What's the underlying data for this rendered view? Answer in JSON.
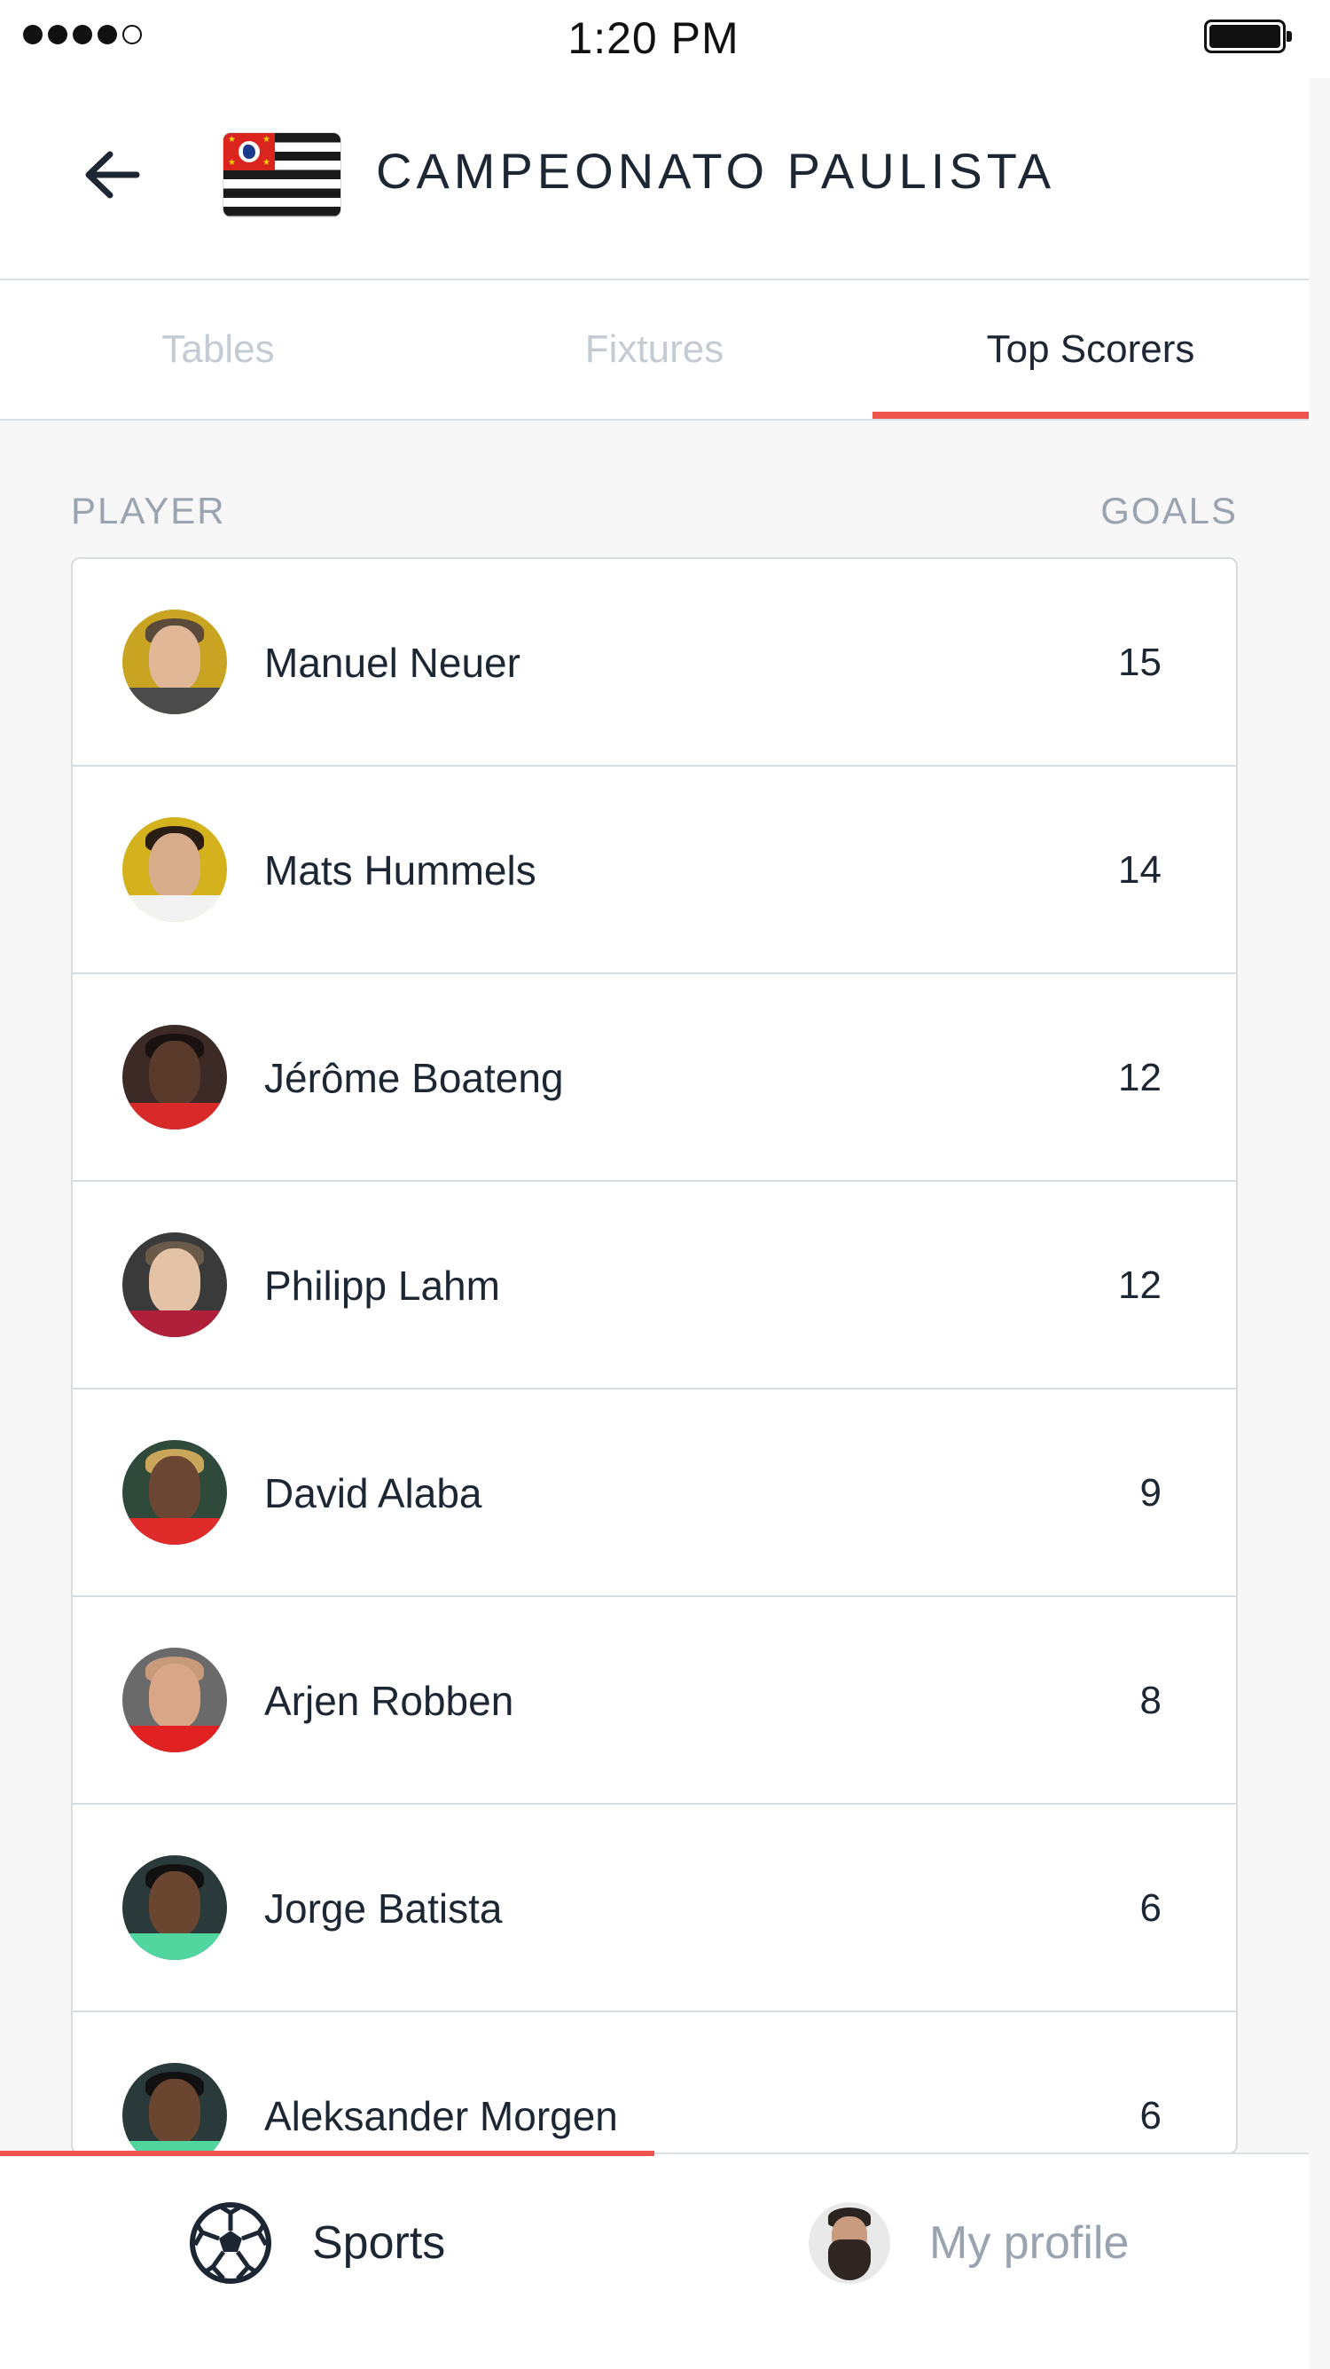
{
  "status_bar": {
    "time": "1:20 PM",
    "signal_bars_filled": 4,
    "signal_bars_total": 5
  },
  "header": {
    "title": "CAMPEONATO PAULISTA",
    "back_icon": "arrow-left-icon",
    "flag_icon": "sao-paulo-flag-icon"
  },
  "tabs": [
    {
      "label": "Tables",
      "active": false
    },
    {
      "label": "Fixtures",
      "active": false
    },
    {
      "label": "Top Scorers",
      "active": true
    }
  ],
  "columns": {
    "player": "PLAYER",
    "goals": "GOALS"
  },
  "players": [
    {
      "name": "Manuel Neuer",
      "goals": "15"
    },
    {
      "name": "Mats Hummels",
      "goals": "14"
    },
    {
      "name": "Jérôme Boateng",
      "goals": "12"
    },
    {
      "name": "Philipp Lahm",
      "goals": "12"
    },
    {
      "name": "David Alaba",
      "goals": "9"
    },
    {
      "name": "Arjen Robben",
      "goals": "8"
    },
    {
      "name": "Jorge Batista",
      "goals": "6"
    },
    {
      "name": "Aleksander Morgen",
      "goals": "6"
    }
  ],
  "bottom_nav": [
    {
      "label": "Sports",
      "icon": "soccer-ball-icon",
      "active": true
    },
    {
      "label": "My profile",
      "icon": "profile-avatar-icon",
      "active": false
    }
  ],
  "colors": {
    "accent": "#f0544f",
    "text_primary": "#1d2633",
    "text_muted": "#9aa3b0",
    "tab_inactive": "#c5cbd3"
  }
}
